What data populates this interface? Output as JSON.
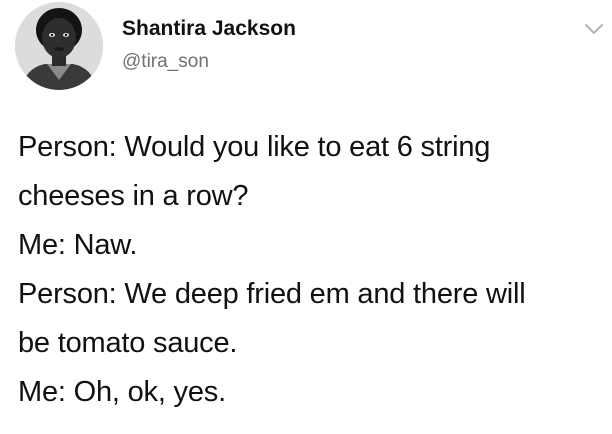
{
  "author": {
    "display_name": "Shantira Jackson",
    "handle": "@tira_son",
    "avatar_icon": "profile-photo"
  },
  "menu": {
    "icon": "chevron-down-icon"
  },
  "tweet": {
    "lines": [
      "Person: Would you like to eat 6 string",
      "cheeses in a row?",
      "Me: Naw.",
      "Person: We deep fried em and there will",
      "be tomato sauce.",
      "Me: Oh, ok, yes."
    ]
  }
}
